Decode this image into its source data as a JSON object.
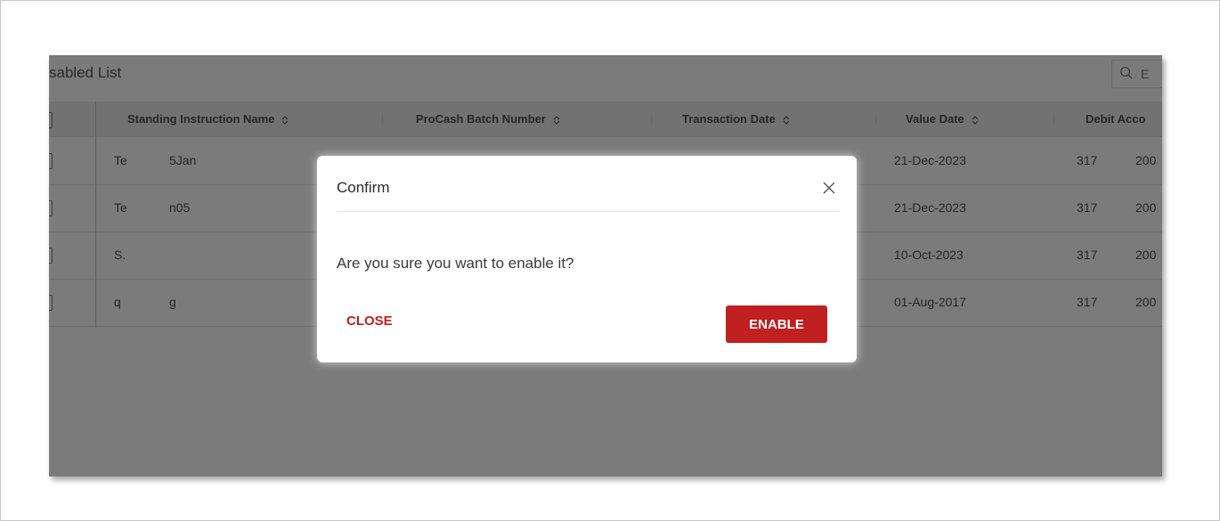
{
  "panel": {
    "title": "sabled List",
    "search_text": "E"
  },
  "table": {
    "columns": [
      "Standing Instruction Name",
      "ProCash Batch Number",
      "Transaction Date",
      "Value Date",
      "Debit Acco"
    ],
    "rows": [
      {
        "name_start": "Te",
        "name_end": "5Jan",
        "value_date": "21-Dec-2023",
        "acct_start": "317",
        "acct_end": "200"
      },
      {
        "name_start": "Te",
        "name_end": "n05",
        "value_date": "21-Dec-2023",
        "acct_start": "317",
        "acct_end": "200"
      },
      {
        "name_start": "S.",
        "name_end": "",
        "value_date": "10-Oct-2023",
        "acct_start": "317",
        "acct_end": "200"
      },
      {
        "name_start": "q",
        "name_end": "g",
        "value_date": "01-Aug-2017",
        "acct_start": "317",
        "acct_end": "200"
      }
    ]
  },
  "modal": {
    "title": "Confirm",
    "message": "Are you sure you want to enable it?",
    "close_label": "CLOSE",
    "enable_label": "ENABLE"
  },
  "colors": {
    "accent": "#c0201f",
    "overlay": "#7b7b7b"
  }
}
